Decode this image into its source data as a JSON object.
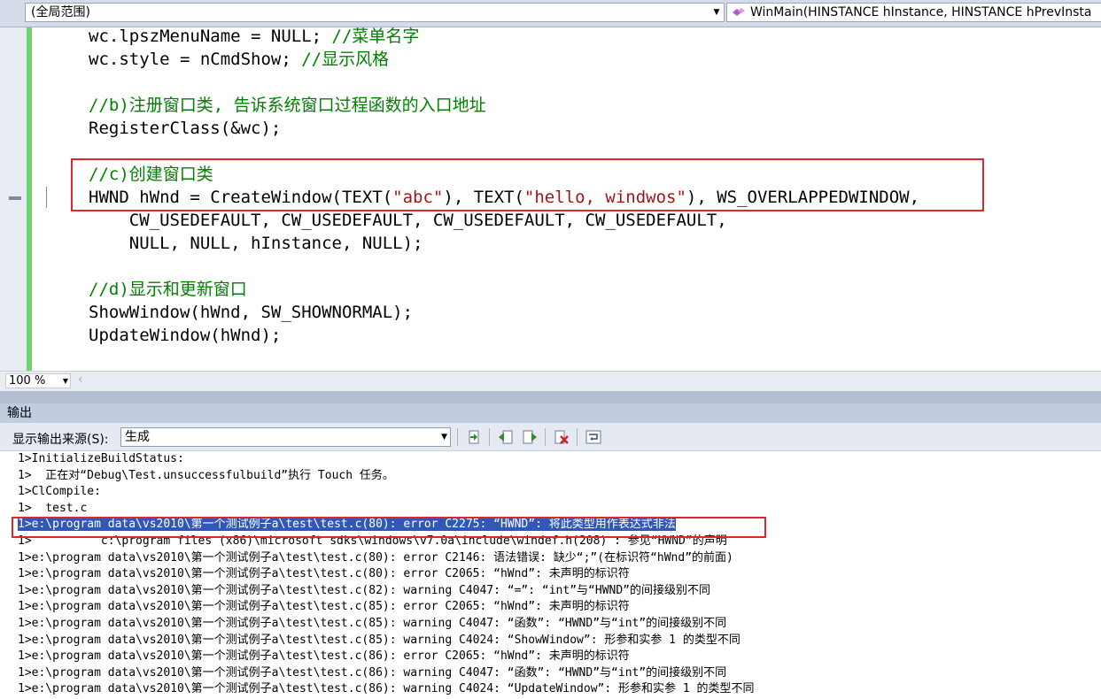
{
  "navbar": {
    "scope": "(全局范围)",
    "member": "WinMain(HINSTANCE hInstance, HINSTANCE hPrevInsta"
  },
  "icons": {
    "dropdown": "chevron-down-icon",
    "method": "method-icon"
  },
  "editor": {
    "lines": [
      "wc.lpszMenuName = NULL; //菜单名字",
      "wc.style = nCmdShow; //显示风格",
      "",
      "//b)注册窗口类, 告诉系统窗口过程函数的入口地址",
      "RegisterClass(&wc);",
      "",
      "//c)创建窗口类",
      "HWND hWnd = CreateWindow(TEXT(\"abc\"), TEXT(\"hello, windwos\"), WS_OVERLAPPEDWINDOW,",
      "    CW_USEDEFAULT, CW_USEDEFAULT, CW_USEDEFAULT, CW_USEDEFAULT,",
      "    NULL, NULL, hInstance, NULL);",
      "",
      "//d)显示和更新窗口",
      "ShowWindow(hWnd, SW_SHOWNORMAL);",
      "UpdateWindow(hWnd);"
    ],
    "zoom": "100 %",
    "comment_color": "#008000",
    "string_color": "#a31515",
    "highlight_color": "#e0262b"
  },
  "output": {
    "title": "输出",
    "source_label": "显示输出来源(S):",
    "source_value": "生成",
    "selected_index": 4,
    "lines": [
      "1>InitializeBuildStatus:",
      "1>  正在对“Debug\\Test.unsuccessfulbuild”执行 Touch 任务。",
      "1>ClCompile:",
      "1>  test.c",
      "1>e:\\program data\\vs2010\\第一个测试例子a\\test\\test.c(80): error C2275: “HWND”: 将此类型用作表达式非法",
      "1>          c:\\program files (x86)\\microsoft sdks\\windows\\v7.0a\\include\\windef.h(208) : 参见“HWND”的声明",
      "1>e:\\program data\\vs2010\\第一个测试例子a\\test\\test.c(80): error C2146: 语法错误: 缺少“;”(在标识符“hWnd”的前面)",
      "1>e:\\program data\\vs2010\\第一个测试例子a\\test\\test.c(80): error C2065: “hWnd”: 未声明的标识符",
      "1>e:\\program data\\vs2010\\第一个测试例子a\\test\\test.c(82): warning C4047: “=”: “int”与“HWND”的间接级别不同",
      "1>e:\\program data\\vs2010\\第一个测试例子a\\test\\test.c(85): error C2065: “hWnd”: 未声明的标识符",
      "1>e:\\program data\\vs2010\\第一个测试例子a\\test\\test.c(85): warning C4047: “函数”: “HWND”与“int”的间接级别不同",
      "1>e:\\program data\\vs2010\\第一个测试例子a\\test\\test.c(85): warning C4024: “ShowWindow”: 形参和实参 1 的类型不同",
      "1>e:\\program data\\vs2010\\第一个测试例子a\\test\\test.c(86): error C2065: “hWnd”: 未声明的标识符",
      "1>e:\\program data\\vs2010\\第一个测试例子a\\test\\test.c(86): warning C4047: “函数”: “HWND”与“int”的间接级别不同",
      "1>e:\\program data\\vs2010\\第一个测试例子a\\test\\test.c(86): warning C4024: “UpdateWindow”: 形参和实参 1 的类型不同"
    ],
    "toolbar_icons": [
      "go-to-location-icon",
      "previous-message-icon",
      "next-message-icon",
      "clear-all-icon",
      "toggle-word-wrap-icon"
    ]
  }
}
